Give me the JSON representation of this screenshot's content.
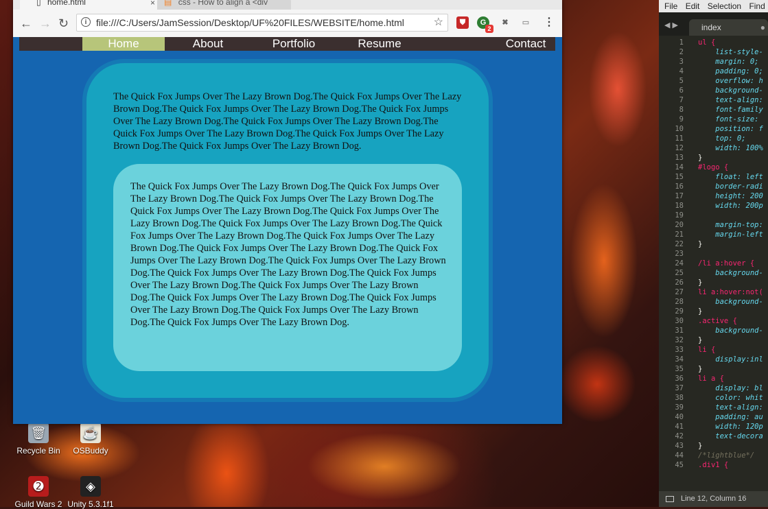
{
  "desktop": {
    "icons": [
      {
        "label": "Recycle Bin",
        "icon": "recycle-bin-icon"
      },
      {
        "label": "OSBuddy",
        "icon": "osbuddy-icon"
      },
      {
        "label": "Guild Wars 2",
        "icon": "guild-wars-icon"
      },
      {
        "label": "Unity 5.3.1f1",
        "icon": "unity-icon"
      }
    ]
  },
  "browser": {
    "tabs": [
      {
        "label": "home.html",
        "active": true
      },
      {
        "label": "css - How to align a <div",
        "active": false
      }
    ],
    "address": "file:///C:/Users/JamSession/Desktop/UF%20FILES/WEBSITE/home.html",
    "extension_badge": "2"
  },
  "site": {
    "nav": [
      {
        "label": "Home",
        "active": true
      },
      {
        "label": "About",
        "active": false
      },
      {
        "label": "Portfolio",
        "active": false
      },
      {
        "label": "Resume",
        "active": false
      },
      {
        "label": "Contact",
        "active": false
      }
    ],
    "outer_text": "The Quick Fox Jumps Over The Lazy Brown Dog.The Quick Fox Jumps Over The Lazy Brown Dog.The Quick Fox Jumps Over The Lazy Brown Dog.The Quick Fox Jumps Over The Lazy Brown Dog.The Quick Fox Jumps Over The Lazy Brown Dog.The Quick Fox Jumps Over The Lazy Brown Dog.The Quick Fox Jumps Over The Lazy Brown Dog.The Quick Fox Jumps Over The Lazy Brown Dog.",
    "inner_text": "The Quick Fox Jumps Over The Lazy Brown Dog.The Quick Fox Jumps Over The Lazy Brown Dog.The Quick Fox Jumps Over The Lazy Brown Dog.The Quick Fox Jumps Over The Lazy Brown Dog.The Quick Fox Jumps Over The Lazy Brown Dog.The Quick Fox Jumps Over The Lazy Brown Dog.The Quick Fox Jumps Over The Lazy Brown Dog.The Quick Fox Jumps Over The Lazy Brown Dog.The Quick Fox Jumps Over The Lazy Brown Dog.The Quick Fox Jumps Over The Lazy Brown Dog.The Quick Fox Jumps Over The Lazy Brown Dog.The Quick Fox Jumps Over The Lazy Brown Dog.The Quick Fox Jumps Over The Lazy Brown Dog.The Quick Fox Jumps Over The Lazy Brown Dog.The Quick Fox Jumps Over The Lazy Brown Dog.The Quick Fox Jumps Over The Lazy Brown Dog.The Quick Fox Jumps Over The Lazy Brown Dog.The Quick Fox Jumps Over The Lazy Brown Dog.",
    "colors": {
      "page_bg": "#1565b0",
      "navbar_bg": "#3b2f2f",
      "active_nav": "#b7c57a",
      "outer_box": "#17a3c0",
      "inner_box": "#6bd2dc"
    }
  },
  "editor": {
    "menu": [
      "File",
      "Edit",
      "Selection",
      "Find"
    ],
    "tab": "index",
    "lines": [
      {
        "n": "1",
        "text": "ul {",
        "kind": "sel"
      },
      {
        "n": "2",
        "text": "    list-style-",
        "kind": "prop"
      },
      {
        "n": "3",
        "text": "    margin: 0;",
        "kind": "prop"
      },
      {
        "n": "4",
        "text": "    padding: 0;",
        "kind": "prop"
      },
      {
        "n": "5",
        "text": "    overflow: h",
        "kind": "prop"
      },
      {
        "n": "6",
        "text": "    background-",
        "kind": "prop"
      },
      {
        "n": "7",
        "text": "    text-align:",
        "kind": "prop"
      },
      {
        "n": "8",
        "text": "    font-family",
        "kind": "prop"
      },
      {
        "n": "9",
        "text": "    font-size:",
        "kind": "prop"
      },
      {
        "n": "10",
        "text": "    position: f",
        "kind": "prop"
      },
      {
        "n": "11",
        "text": "    top: 0;",
        "kind": "prop"
      },
      {
        "n": "12",
        "text": "    width: 100%",
        "kind": "prop"
      },
      {
        "n": "13",
        "text": "}",
        "kind": "brace"
      },
      {
        "n": "14",
        "text": "#logo {",
        "kind": "sel"
      },
      {
        "n": "15",
        "text": "    float: left",
        "kind": "prop"
      },
      {
        "n": "16",
        "text": "    border-radi",
        "kind": "prop"
      },
      {
        "n": "17",
        "text": "    height: 200",
        "kind": "prop"
      },
      {
        "n": "18",
        "text": "    width: 200p",
        "kind": "prop"
      },
      {
        "n": "19",
        "text": "",
        "kind": "brace"
      },
      {
        "n": "20",
        "text": "    margin-top:",
        "kind": "prop"
      },
      {
        "n": "21",
        "text": "    margin-left",
        "kind": "prop"
      },
      {
        "n": "22",
        "text": "}",
        "kind": "brace"
      },
      {
        "n": "23",
        "text": "",
        "kind": "brace"
      },
      {
        "n": "24",
        "text": "/li a:hover {",
        "kind": "sel"
      },
      {
        "n": "25",
        "text": "    background-",
        "kind": "prop"
      },
      {
        "n": "26",
        "text": "}",
        "kind": "brace"
      },
      {
        "n": "27",
        "text": "li a:hover:not(",
        "kind": "sel"
      },
      {
        "n": "28",
        "text": "    background-",
        "kind": "prop"
      },
      {
        "n": "29",
        "text": "}",
        "kind": "brace"
      },
      {
        "n": "30",
        "text": ".active {",
        "kind": "sel"
      },
      {
        "n": "31",
        "text": "    background-",
        "kind": "prop"
      },
      {
        "n": "32",
        "text": "}",
        "kind": "brace"
      },
      {
        "n": "33",
        "text": "li {",
        "kind": "sel"
      },
      {
        "n": "34",
        "text": "    display:inl",
        "kind": "prop"
      },
      {
        "n": "35",
        "text": "}",
        "kind": "brace"
      },
      {
        "n": "36",
        "text": "li a {",
        "kind": "sel"
      },
      {
        "n": "37",
        "text": "    display: bl",
        "kind": "prop"
      },
      {
        "n": "38",
        "text": "    color: whit",
        "kind": "prop"
      },
      {
        "n": "39",
        "text": "    text-align:",
        "kind": "prop"
      },
      {
        "n": "40",
        "text": "    padding: au",
        "kind": "prop"
      },
      {
        "n": "41",
        "text": "    width: 120p",
        "kind": "prop"
      },
      {
        "n": "42",
        "text": "    text-decora",
        "kind": "prop"
      },
      {
        "n": "43",
        "text": "}",
        "kind": "brace"
      },
      {
        "n": "44",
        "text": "/*lightblue*/",
        "kind": "cmt"
      },
      {
        "n": "45",
        "text": ".div1 {",
        "kind": "sel"
      }
    ],
    "status": "Line 12, Column 16"
  }
}
